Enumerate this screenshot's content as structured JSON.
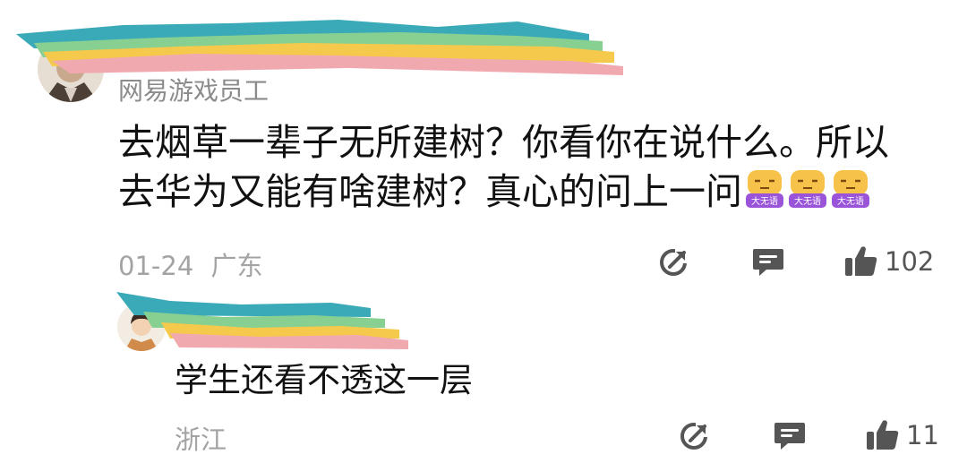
{
  "comments": [
    {
      "username": "网易游戏员工",
      "text": "去烟草一辈子无所建树？你看你在说什么。所以去华为又能有啥建树？真心的问上一问",
      "emoji_label": "大无语",
      "emoji_count": 3,
      "date": "01-24",
      "location": "广东",
      "likes": "102"
    },
    {
      "text": "学生还看不透这一层",
      "location": "浙江",
      "likes": "11"
    }
  ],
  "icons": {
    "share": "share-icon",
    "reply": "reply-icon",
    "like": "thumbs-up-icon"
  },
  "colors": {
    "text": "#111111",
    "meta": "#a3a3a3",
    "username": "#8b8b8b",
    "icon": "#555555",
    "emoji_face": "#f7c24a",
    "emoji_label_bg": "#9a54d9"
  }
}
